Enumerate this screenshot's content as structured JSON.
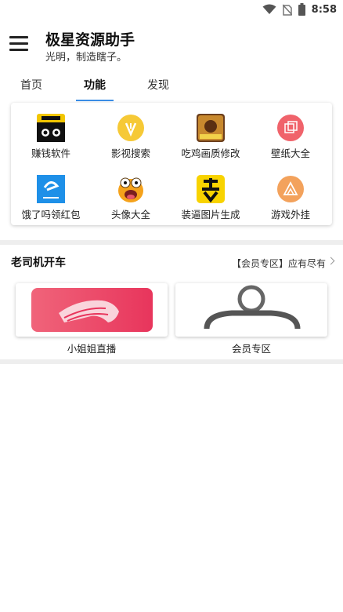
{
  "status_bar": {
    "time": "8:58",
    "icons": [
      "wifi-icon",
      "no-sim-icon",
      "battery-icon"
    ]
  },
  "app_bar": {
    "title": "极星资源助手",
    "subtitle": "光明，制造瞎子。"
  },
  "tabs": [
    {
      "label": "首页",
      "active": false
    },
    {
      "label": "功能",
      "active": true
    },
    {
      "label": "发现",
      "active": false
    }
  ],
  "features": [
    {
      "label": "赚钱软件",
      "icon": "reward-cat-icon",
      "color": "#f2c600"
    },
    {
      "label": "影视搜索",
      "icon": "video-search-icon",
      "color": "#f6c936"
    },
    {
      "label": "吃鸡画质修改",
      "icon": "game-graphics-icon",
      "color": "#8a5a2a"
    },
    {
      "label": "壁纸大全",
      "icon": "wallpaper-icon",
      "color": "#f0636b"
    },
    {
      "label": "饿了吗领红包",
      "icon": "eleme-icon",
      "color": "#1e90e8"
    },
    {
      "label": "头像大全",
      "icon": "avatar-face-icon",
      "color": "#f5a21b"
    },
    {
      "label": "装逼图片生成",
      "icon": "fake-image-icon",
      "color": "#f8d300"
    },
    {
      "label": "游戏外挂",
      "icon": "game-hack-icon",
      "color": "#f3a25c"
    }
  ],
  "section": {
    "title": "老司机开车",
    "more": "【会员专区】应有尽有"
  },
  "tiles": [
    {
      "label": "小姐姐直播",
      "icon": "live-stream-icon",
      "color": "#ee4d6c"
    },
    {
      "label": "会员专区",
      "icon": "member-user-icon",
      "color": "#6e6e6e"
    }
  ],
  "colors": {
    "accent": "#3b8ee6",
    "divider": "#eeeeee"
  }
}
